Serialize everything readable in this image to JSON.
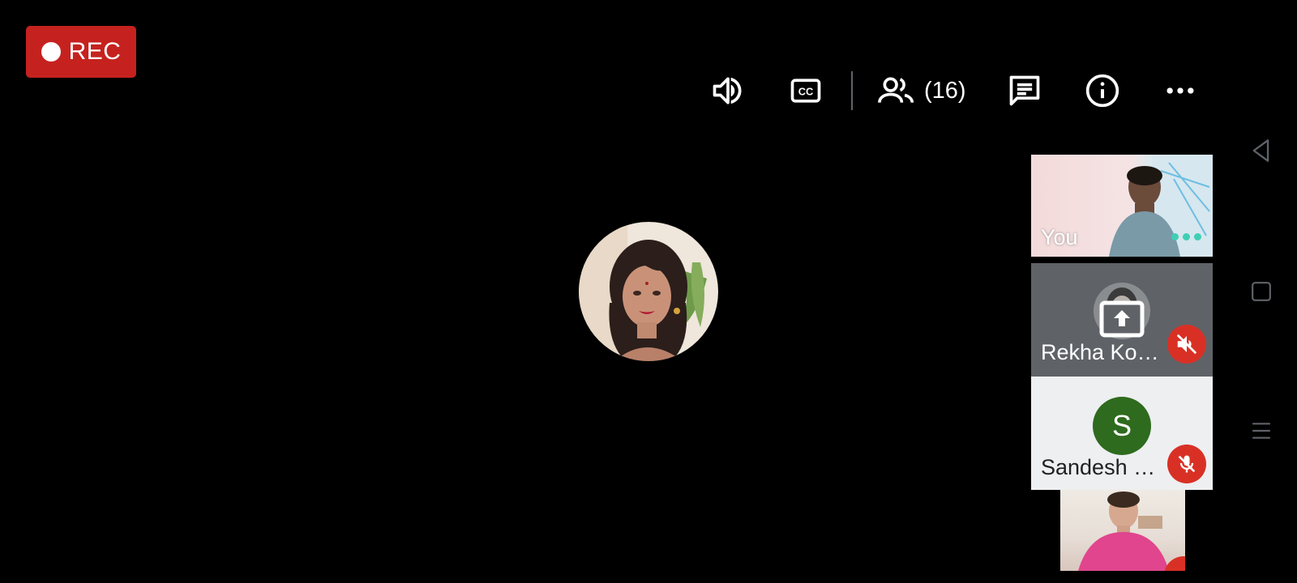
{
  "recording": {
    "label": "REC"
  },
  "toolbar": {
    "speaker_icon": "volume-up-icon",
    "captions_icon": "closed-captions-icon",
    "people_icon": "people-icon",
    "people_count": "(16)",
    "chat_icon": "chat-icon",
    "info_icon": "info-icon",
    "more_icon": "more-horizontal-icon"
  },
  "main_stage": {
    "speaker_avatar": "participant-photo"
  },
  "tiles": [
    {
      "name": "You",
      "state": "speaking"
    },
    {
      "name": "Rekha Ko…",
      "state": "presenting",
      "status_icon": "speaker-muted-icon"
    },
    {
      "name": "Sandesh …",
      "initial": "S",
      "avatar_color": "#2e6b1e",
      "status_icon": "mic-off-icon"
    }
  ],
  "system_nav": {
    "back": "back-triangle-icon",
    "home": "home-square-icon",
    "menu": "menu-lines-icon"
  },
  "colors": {
    "rec_red": "#c5221f",
    "mute_red": "#d93025",
    "speaking": "#3fcfb4"
  }
}
